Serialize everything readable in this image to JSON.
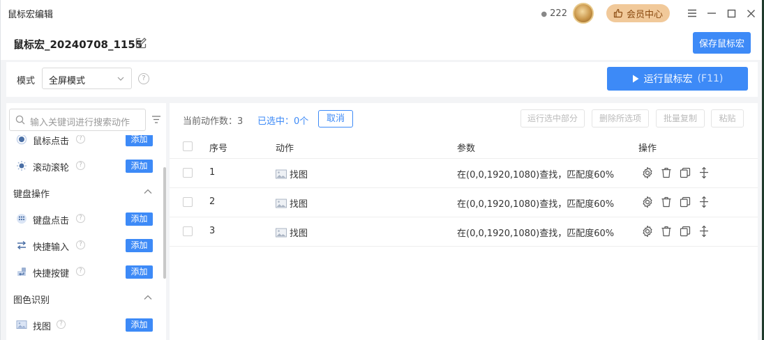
{
  "window": {
    "title": "鼠标宏编辑"
  },
  "titlebar": {
    "coin_count": "222",
    "vip_label": "会员中心"
  },
  "macro": {
    "name": "鼠标宏_20240708_1155",
    "save_label": "保存鼠标宏"
  },
  "mode": {
    "label": "模式",
    "value": "全屏模式"
  },
  "run": {
    "label": "运行鼠标宏",
    "shortcut": "(F11)"
  },
  "sidebar": {
    "search_placeholder": "输入关键词进行搜索动作",
    "add_label": "添加",
    "items": [
      {
        "type": "item",
        "label": "鼠标点击",
        "icon": "mouse-click-icon"
      },
      {
        "type": "item",
        "label": "滚动滚轮",
        "icon": "scroll-wheel-icon"
      },
      {
        "type": "group",
        "label": "键盘操作"
      },
      {
        "type": "item",
        "label": "键盘点击",
        "icon": "keyboard-icon"
      },
      {
        "type": "item",
        "label": "快捷输入",
        "icon": "quick-input-icon"
      },
      {
        "type": "item",
        "label": "快捷按键",
        "icon": "hotkey-icon"
      },
      {
        "type": "group",
        "label": "图色识别"
      },
      {
        "type": "item",
        "label": "找图",
        "icon": "image-icon"
      }
    ]
  },
  "main": {
    "count_text": "当前动作数：3",
    "selected_text": "已选中：0个",
    "cancel_label": "取消",
    "buttons": {
      "run_selected": "运行选中部分",
      "delete_selected": "删除所选项",
      "batch_copy": "批量复制",
      "paste": "粘贴"
    },
    "columns": {
      "index": "序号",
      "action": "动作",
      "params": "参数",
      "ops": "操作"
    },
    "rows": [
      {
        "index": "1",
        "action": "找图",
        "params": "在(0,0,1920,1080)查找，匹配度60%"
      },
      {
        "index": "2",
        "action": "找图",
        "params": "在(0,0,1920,1080)查找，匹配度60%"
      },
      {
        "index": "3",
        "action": "找图",
        "params": "在(0,0,1920,1080)查找，匹配度60%"
      }
    ]
  },
  "colors": {
    "accent": "#3d8af7",
    "vip_bg": "#f1c99a",
    "vip_text": "#8a4a10"
  }
}
